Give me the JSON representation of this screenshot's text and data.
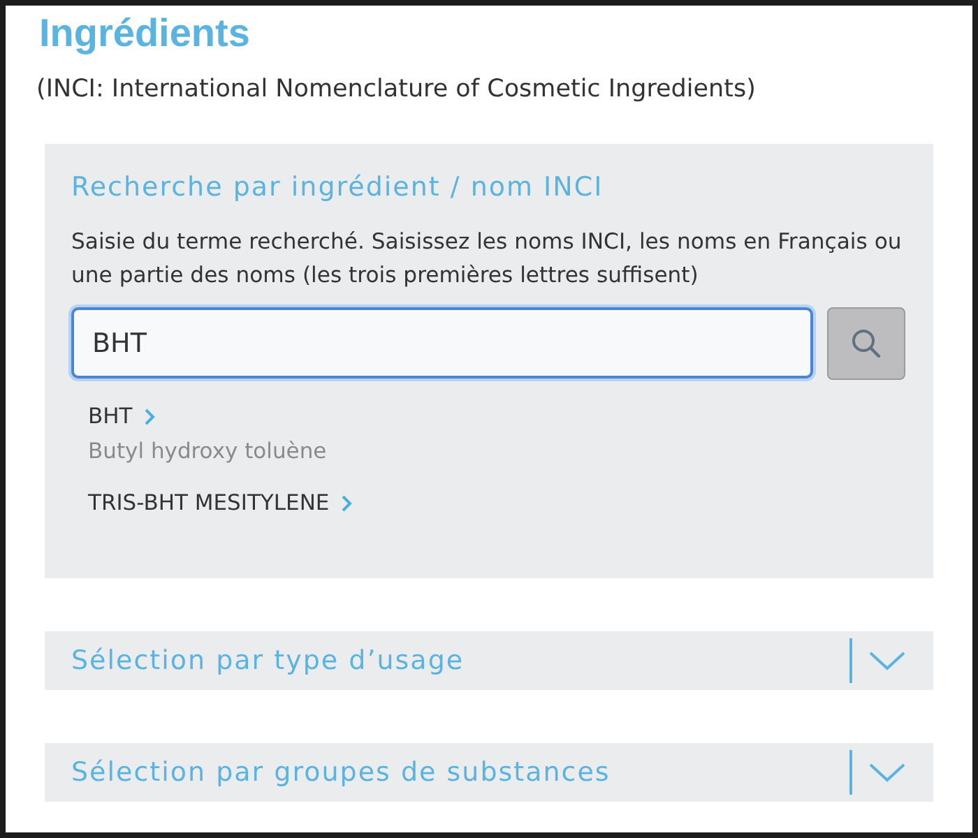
{
  "title": "Ingrédients",
  "subtitle": "(INCI: International Nomenclature of Cosmetic Ingredients)",
  "search_panel": {
    "title": "Recherche par ingrédient / nom INCI",
    "description": "Saisie du terme recherché. Saisissez les noms INCI, les noms en Français ou une partie des noms (les trois premières lettres suffisent)",
    "search_field": {
      "value": "BHT"
    },
    "results": [
      {
        "name": "BHT",
        "alias": "Butyl hydroxy toluène"
      },
      {
        "name": "TRIS-BHT MESITYLENE"
      }
    ]
  },
  "sections": [
    {
      "title": "Sélection par type d’usage",
      "expanded": false
    },
    {
      "title": "Sélection par groupes de substances",
      "expanded": false
    }
  ]
}
